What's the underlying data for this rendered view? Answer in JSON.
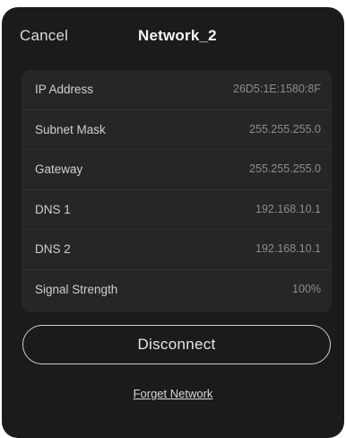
{
  "header": {
    "cancel_label": "Cancel",
    "title": "Network_2"
  },
  "details": {
    "rows": [
      {
        "label": "IP Address",
        "value": "26D5:1E:1580:8F"
      },
      {
        "label": "Subnet Mask",
        "value": "255.255.255.0"
      },
      {
        "label": "Gateway",
        "value": "255.255.255.0"
      },
      {
        "label": "DNS 1",
        "value": "192.168.10.1"
      },
      {
        "label": "DNS 2",
        "value": "192.168.10.1"
      },
      {
        "label": "Signal Strength",
        "value": "100%"
      }
    ]
  },
  "actions": {
    "disconnect_label": "Disconnect",
    "forget_label": "Forget Network"
  },
  "colors": {
    "background": "#1b1b1b",
    "card": "#262626",
    "text_primary": "#f5f5f5",
    "text_secondary": "#8c8c8c"
  }
}
